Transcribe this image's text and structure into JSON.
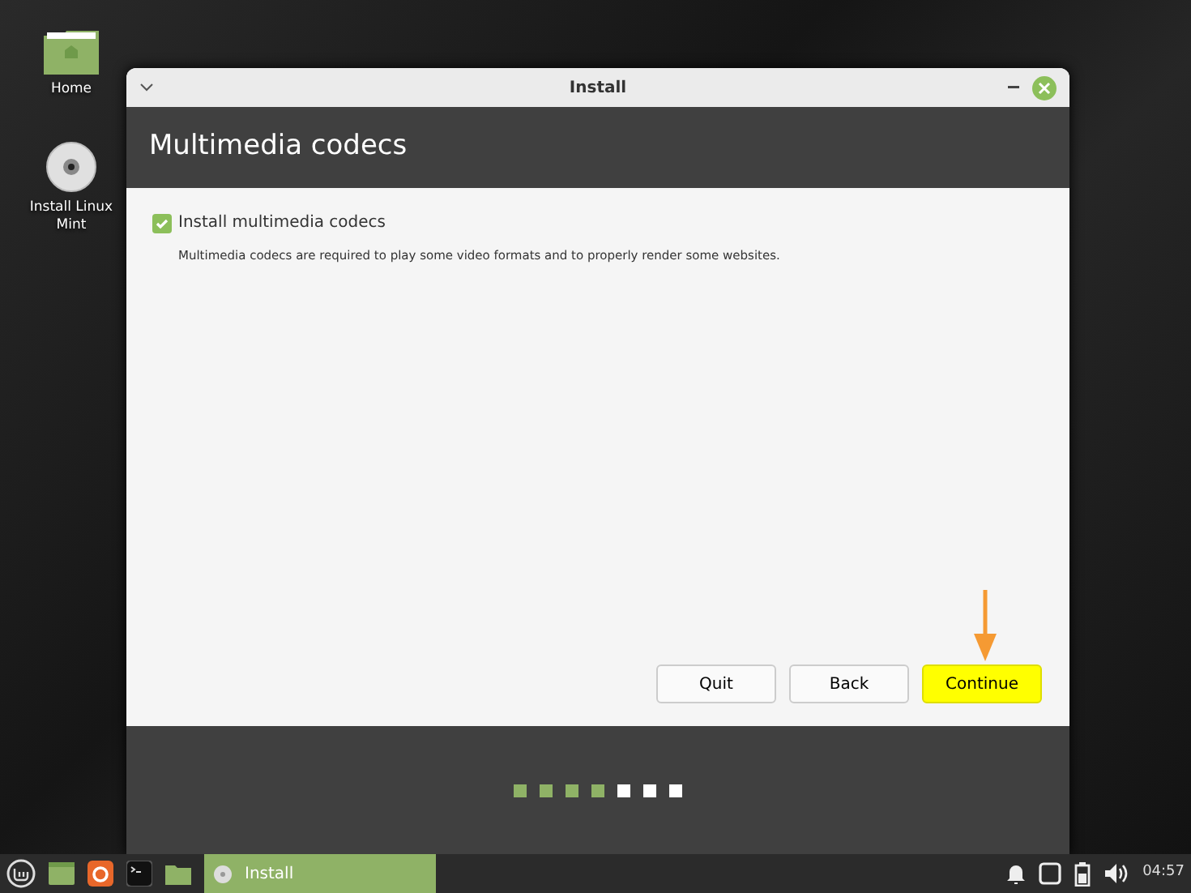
{
  "desktop_icons": [
    {
      "kind": "folder",
      "label": "Home"
    },
    {
      "kind": "disc",
      "label": "Install Linux Mint"
    }
  ],
  "window": {
    "title": "Install",
    "heading": "Multimedia codecs",
    "option": {
      "label": "Install multimedia codecs",
      "checked": true
    },
    "description": "Multimedia codecs are required to play some video formats and to properly render some websites.",
    "buttons": [
      {
        "label": "Quit",
        "highlighted": false
      },
      {
        "label": "Back",
        "highlighted": false
      },
      {
        "label": "Continue",
        "highlighted": true
      }
    ],
    "progress_steps": [
      {
        "done": true
      },
      {
        "done": true
      },
      {
        "done": true
      },
      {
        "done": true
      },
      {
        "done": false
      },
      {
        "done": false
      },
      {
        "done": false
      }
    ]
  },
  "taskbar": {
    "task": {
      "label": "Install",
      "selected": true
    },
    "clock": "04:57"
  }
}
